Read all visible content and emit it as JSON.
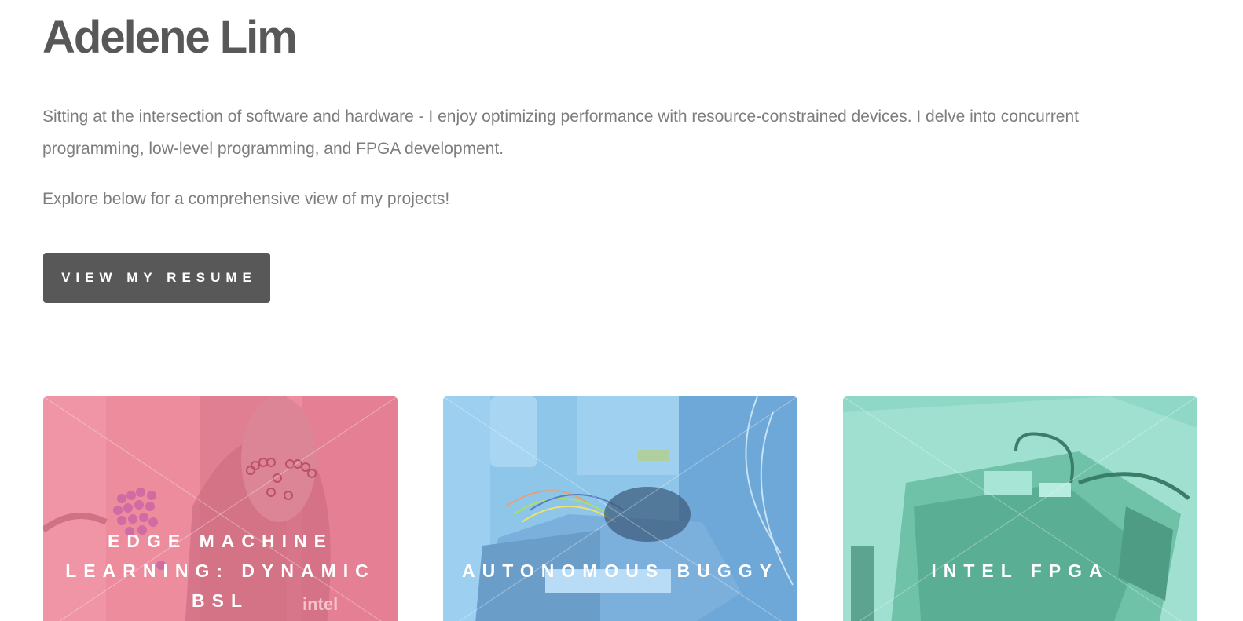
{
  "header": {
    "name": "Adelene Lim"
  },
  "intro": {
    "paragraph": "Sitting at the intersection of software and hardware - I enjoy optimizing performance with resource-constrained devices. I delve into concurrent programming, low-level programming, and FPGA development.",
    "explore": "Explore below for a comprehensive view of my projects!"
  },
  "actions": {
    "resume_label": "VIEW MY RESUME"
  },
  "projects": [
    {
      "title": "EDGE MACHINE LEARNING: DYNAMIC BSL",
      "color": "#ec8a9c"
    },
    {
      "title": "AUTONOMOUS BUGGY",
      "color": "#8cc8ec"
    },
    {
      "title": "INTEL FPGA",
      "color": "#8ed9c8"
    }
  ],
  "icons": {
    "ml-photo": "person-face-mesh-photo",
    "buggy-photo": "robot-buggy-photo",
    "fpga-photo": "circuit-board-photo"
  }
}
